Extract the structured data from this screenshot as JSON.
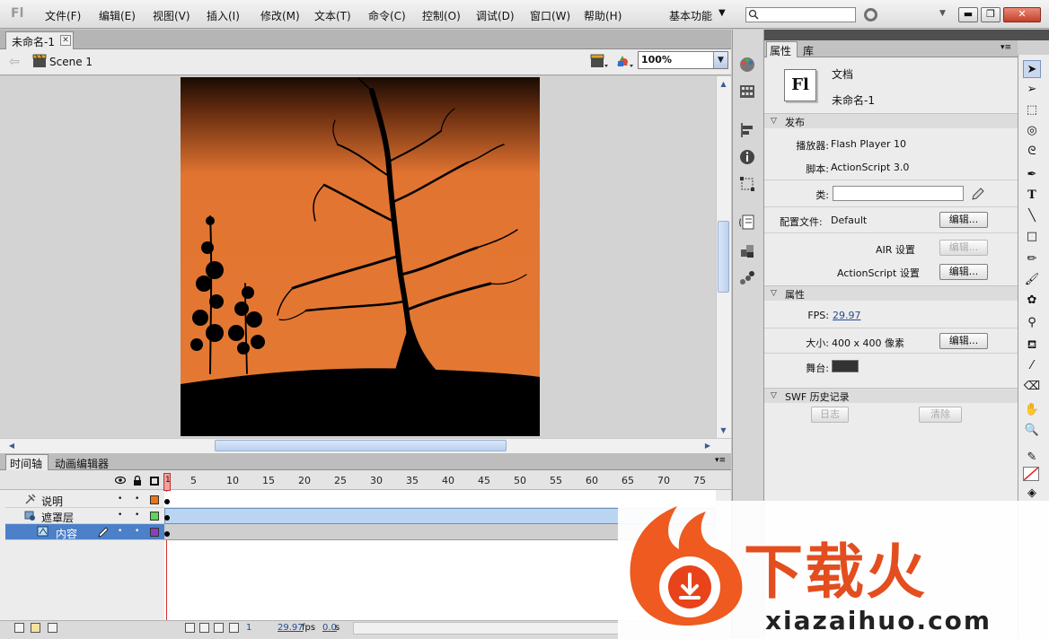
{
  "app": {
    "logo": "Fl"
  },
  "menu": [
    "文件(F)",
    "编辑(E)",
    "视图(V)",
    "插入(I)",
    "修改(M)",
    "文本(T)",
    "命令(C)",
    "控制(O)",
    "调试(D)",
    "窗口(W)",
    "帮助(H)"
  ],
  "workspace": {
    "label": "基本功能"
  },
  "search": {
    "placeholder": ""
  },
  "window_controls": {
    "minimize": "▬",
    "maximize": "❐",
    "close": "✕"
  },
  "document": {
    "tab_label": "未命名-1",
    "close": "✕"
  },
  "edit_bar": {
    "scene_label": "Scene 1",
    "zoom": "100%"
  },
  "timeline": {
    "tabs": [
      "时间轴",
      "动画编辑器"
    ],
    "frame_numbers": [
      "5",
      "10",
      "15",
      "20",
      "25",
      "30",
      "35",
      "40",
      "45",
      "50",
      "55",
      "60",
      "65",
      "70",
      "75"
    ],
    "playhead_label": "1",
    "layers": [
      {
        "name": "说明",
        "color": "#e8741b"
      },
      {
        "name": "遮罩层",
        "color": "#5ad65a"
      },
      {
        "name": "内容",
        "color": "#8b3fbf"
      }
    ],
    "footer": {
      "frame": "1",
      "fps": "29.97",
      "fps_unit": "fps",
      "time": "0.0",
      "time_unit": "s"
    }
  },
  "properties": {
    "tabs": [
      "属性",
      "库"
    ],
    "doc_icon": "Fl",
    "doc_type": "文档",
    "doc_name": "未命名-1",
    "publish": {
      "section": "发布",
      "player_label": "播放器:",
      "player_value": "Flash Player 10",
      "script_label": "脚本:",
      "script_value": "ActionScript 3.0",
      "class_label": "类:",
      "profile_label": "配置文件:",
      "profile_value": "Default",
      "edit_button": "编辑...",
      "air_label": "AIR 设置",
      "air_button": "编辑...",
      "as_label": "ActionScript 设置",
      "as_button": "编辑..."
    },
    "attributes": {
      "section": "属性",
      "fps_label": "FPS:",
      "fps_value": "29.97",
      "size_label": "大小:",
      "size_value": "400 x 400 像素",
      "size_button": "编辑...",
      "stage_label": "舞台:",
      "stage_color": "#333333"
    },
    "swf": {
      "section": "SWF 历史记录",
      "log_button": "日志",
      "clear_button": "清除"
    }
  },
  "tools": [
    "selection-icon",
    "subselection-icon",
    "free-transform-icon",
    "3d-rotation-icon",
    "lasso-icon",
    "pen-icon",
    "text-icon",
    "line-icon",
    "rectangle-icon",
    "pencil-icon",
    "brush-icon",
    "deco-icon",
    "bone-icon",
    "paint-bucket-icon",
    "eyedropper-icon",
    "eraser-icon",
    "hand-icon",
    "zoom-icon",
    "stroke-color-icon",
    "fill-color-icon"
  ],
  "colors": {
    "accent": "#3a5d92",
    "stage_bg": "#e27431",
    "watermark": "#e34e1f"
  },
  "watermark": {
    "brand": "下载火",
    "domain": "xiazaihuo.com"
  }
}
